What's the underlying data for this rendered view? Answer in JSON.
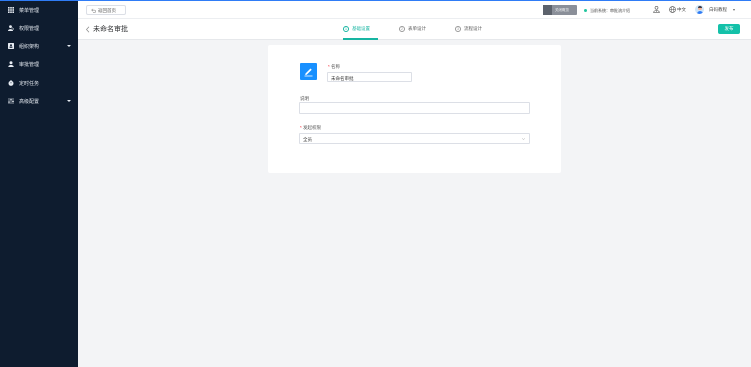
{
  "sidebar": {
    "items": [
      {
        "label": "菜单管理",
        "icon": "grid-icon",
        "has_submenu": false
      },
      {
        "label": "权限管理",
        "icon": "user-permission-icon",
        "has_submenu": false
      },
      {
        "label": "组织架构",
        "icon": "org-chart-icon",
        "has_submenu": true
      },
      {
        "label": "审批管理",
        "icon": "approver-icon",
        "has_submenu": false
      },
      {
        "label": "定时任务",
        "icon": "timer-icon",
        "has_submenu": false
      },
      {
        "label": "高级配置",
        "icon": "advanced-config-icon",
        "has_submenu": true
      }
    ]
  },
  "topbar": {
    "back_home_label": "返回首页",
    "mode_badge_label": "关闭概览",
    "system_status_label": "当前系统：审批流介绍",
    "language_label": "中文",
    "user_name": "白码教程"
  },
  "subbar": {
    "page_title": "未命名审批",
    "steps": [
      {
        "number": "1",
        "label": "基础设置",
        "active": true
      },
      {
        "number": "2",
        "label": "表单设计",
        "active": false
      },
      {
        "number": "3",
        "label": "流程设计",
        "active": false
      }
    ],
    "publish_label": "发布"
  },
  "form": {
    "required_mark": "*",
    "name_label": "名称",
    "name_value": "未命名审批",
    "description_label": "说明",
    "description_value": "",
    "initiator_label": "发起权限",
    "initiator_value": "全员"
  },
  "colors": {
    "sidebar_bg": "#0e1c2f",
    "accent_teal": "#17b5a2",
    "publish_bg": "#14c1a9",
    "icon_blue": "#1890ff",
    "page_bg": "#f3f4f6"
  }
}
